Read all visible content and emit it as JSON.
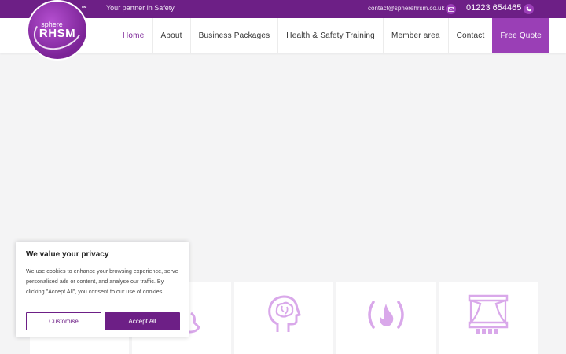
{
  "topbar": {
    "tm": "™",
    "tagline": "Your partner in Safety",
    "email": "contact@spherehrsm.co.uk",
    "phone": "01223 654465"
  },
  "logo": {
    "line1": "sphere",
    "line2": "RHSM"
  },
  "nav": {
    "items": [
      {
        "label": "Home"
      },
      {
        "label": "About"
      },
      {
        "label": "Business Packages"
      },
      {
        "label": "Health & Safety Training"
      },
      {
        "label": "Member area"
      },
      {
        "label": "Contact"
      }
    ],
    "quote_label": "Free Quote"
  },
  "cookie": {
    "title": "We value your privacy",
    "text": "We use cookies to enhance your browsing experience, serve personalised ads or content, and analyse our traffic. By clicking \"Accept All\", you consent to our use of cookies.",
    "customise_label": "Customise",
    "accept_label": "Accept All"
  },
  "cards": [
    {
      "icon": "card-icon-partial-1"
    },
    {
      "icon": "card-icon-partial-2"
    },
    {
      "icon": "head-brain-icon"
    },
    {
      "icon": "fire-icon"
    },
    {
      "icon": "theatre-stage-icon"
    }
  ],
  "colors": {
    "brand": "#6d1f86",
    "accent": "#9a3fb6",
    "icon": "#d9a8ea"
  }
}
